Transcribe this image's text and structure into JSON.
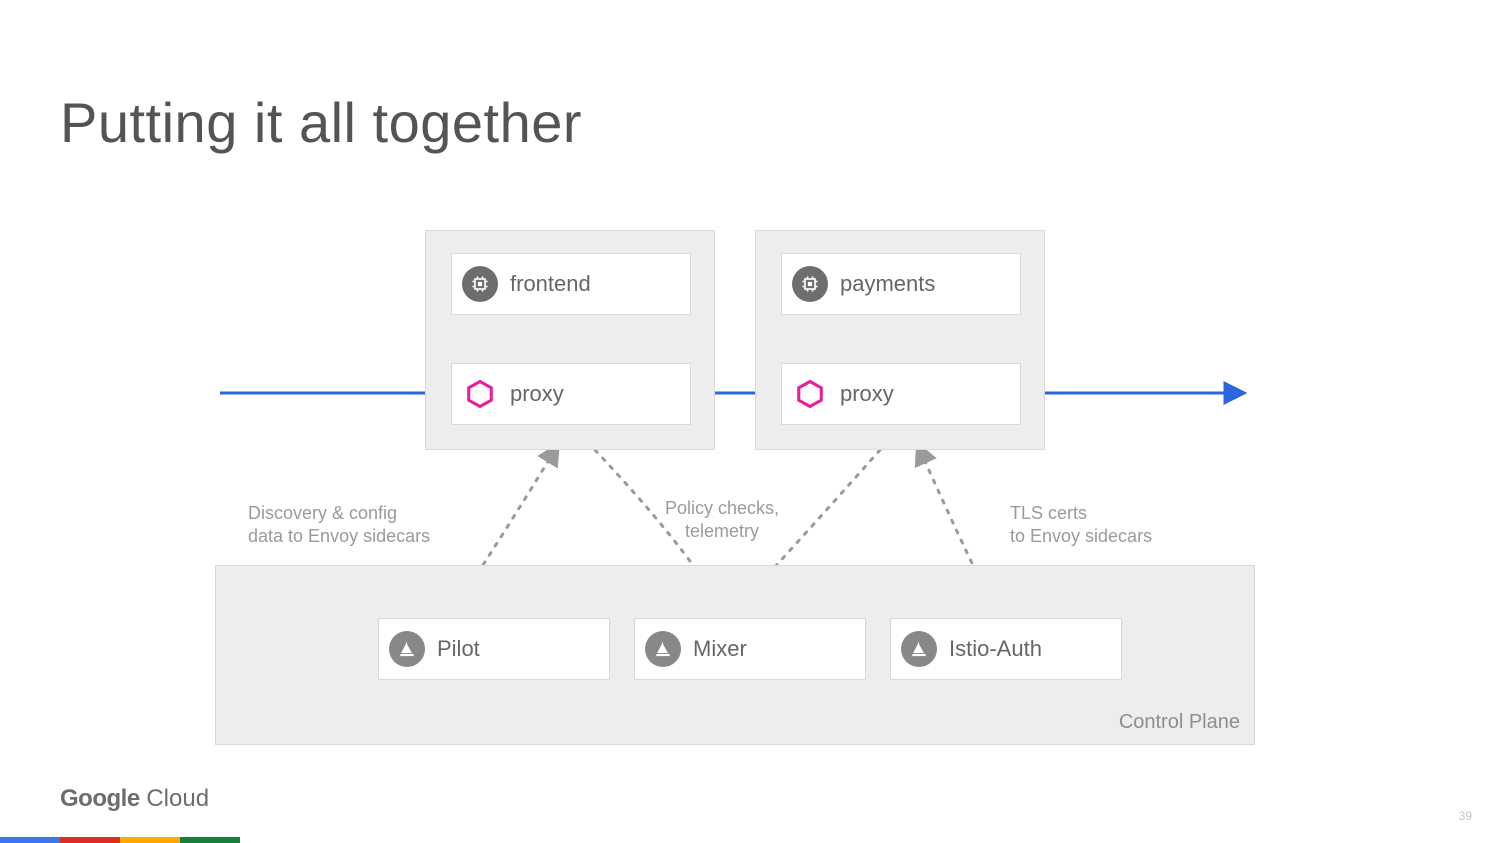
{
  "title": "Putting it all together",
  "footer": {
    "logo_strong": "Google",
    "logo_light": " Cloud",
    "page": "39"
  },
  "colorbar": [
    "#3b78e7",
    "#d93025",
    "#f9ab00",
    "#188038"
  ],
  "pods": {
    "left": {
      "service": "frontend",
      "proxy": "proxy"
    },
    "right": {
      "service": "payments",
      "proxy": "proxy"
    }
  },
  "control_plane": {
    "label": "Control Plane",
    "components": {
      "pilot": "Pilot",
      "mixer": "Mixer",
      "auth": "Istio-Auth"
    }
  },
  "annotations": {
    "discovery": "Discovery & config\ndata to Envoy sidecars",
    "policy": "Policy checks,\ntelemetry",
    "tls": "TLS certs\nto Envoy sidecars"
  }
}
